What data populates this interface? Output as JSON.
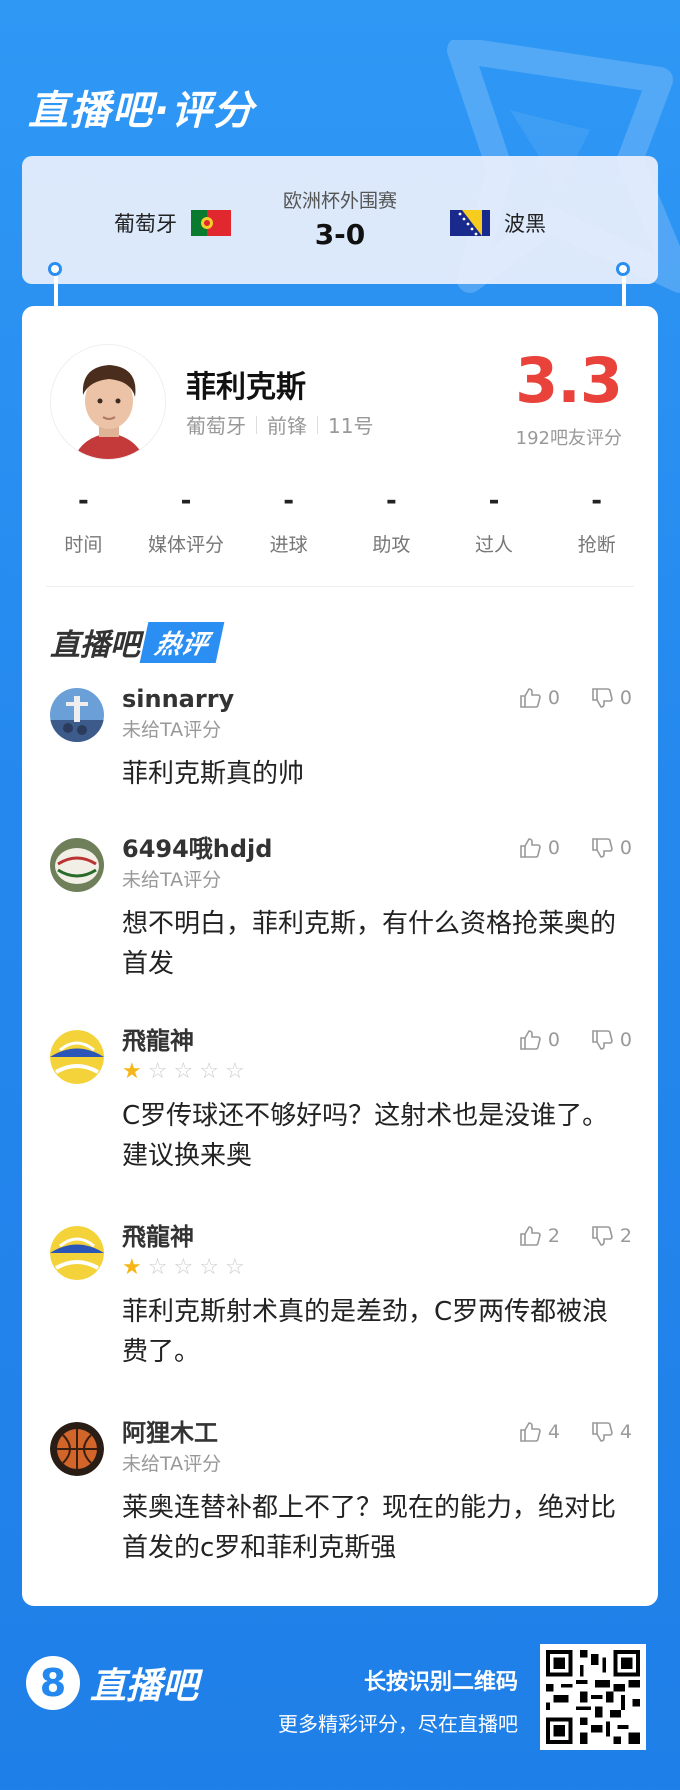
{
  "header": {
    "title": "直播吧·评分"
  },
  "match": {
    "home_team": "葡萄牙",
    "away_team": "波黑",
    "competition": "欧洲杯外围赛",
    "score": "3-0"
  },
  "player": {
    "name": "菲利克斯",
    "team": "葡萄牙",
    "position": "前锋",
    "number": "11号",
    "rating": "3.3",
    "rating_label": "192吧友评分"
  },
  "stats": [
    {
      "value": "-",
      "label": "时间"
    },
    {
      "value": "-",
      "label": "媒体评分"
    },
    {
      "value": "-",
      "label": "进球"
    },
    {
      "value": "-",
      "label": "助攻"
    },
    {
      "value": "-",
      "label": "过人"
    },
    {
      "value": "-",
      "label": "抢断"
    }
  ],
  "hot": {
    "brand": "直播吧",
    "tag": "热评"
  },
  "comments": [
    {
      "user": "sinnarry",
      "sub": "未给TA评分",
      "stars": 0,
      "text": "菲利克斯真的帅",
      "likes": "0",
      "dislikes": "0"
    },
    {
      "user": "6494哦hdjd",
      "sub": "未给TA评分",
      "stars": 0,
      "text": "想不明白，菲利克斯，有什么资格抢莱奥的首发",
      "likes": "0",
      "dislikes": "0"
    },
    {
      "user": "飛龍神",
      "sub": "",
      "stars": 1,
      "text": "C罗传球还不够好吗？这射术也是没谁了。建议换来奥",
      "likes": "0",
      "dislikes": "0"
    },
    {
      "user": "飛龍神",
      "sub": "",
      "stars": 1,
      "text": "菲利克斯射术真的是差劲，C罗两传都被浪费了。",
      "likes": "2",
      "dislikes": "2"
    },
    {
      "user": "阿狸木工",
      "sub": "未给TA评分",
      "stars": 0,
      "text": "莱奥连替补都上不了？现在的能力，绝对比首发的c罗和菲利克斯强",
      "likes": "4",
      "dislikes": "4"
    }
  ],
  "footer": {
    "logo_digit": "8",
    "logo_text": "直播吧",
    "cta": "长按识别二维码",
    "tagline": "更多精彩评分，尽在直播吧"
  },
  "colors": {
    "brand": "#2488ee",
    "rating": "#e8423a",
    "star": "#f5b619"
  }
}
